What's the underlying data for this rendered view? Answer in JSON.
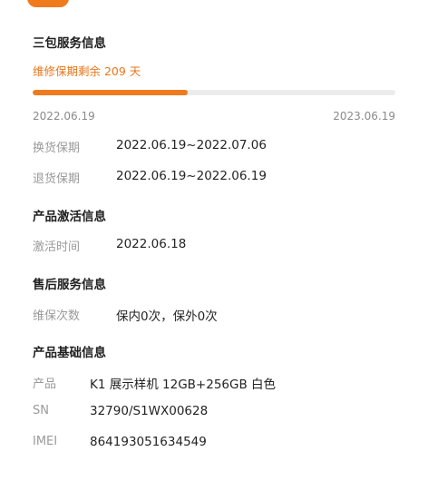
{
  "warranty": {
    "title": "三包服务信息",
    "remaining_text": "维修保期剩余 209 天",
    "progress_fraction": 0.428,
    "start_date": "2022.06.19",
    "end_date": "2023.06.19",
    "rows": [
      {
        "label": "换货保期",
        "value": "2022.06.19~2022.07.06"
      },
      {
        "label": "退货保期",
        "value": "2022.06.19~2022.06.19"
      }
    ]
  },
  "activation": {
    "title": "产品激活信息",
    "rows": [
      {
        "label": "激活时间",
        "value": "2022.06.18"
      }
    ]
  },
  "after_sales": {
    "title": "售后服务信息",
    "rows": [
      {
        "label": "维保次数",
        "value": "保内0次，保外0次"
      }
    ]
  },
  "product": {
    "title": "产品基础信息",
    "rows": [
      {
        "label": "产品",
        "value": "K1 展示样机 12GB+256GB 白色"
      },
      {
        "label": "SN",
        "value": "32790/S1WX00628"
      },
      {
        "label": "IMEI",
        "value": "864193051634549"
      }
    ]
  },
  "colors": {
    "accent": "#f07a1e",
    "track": "#ececec"
  }
}
